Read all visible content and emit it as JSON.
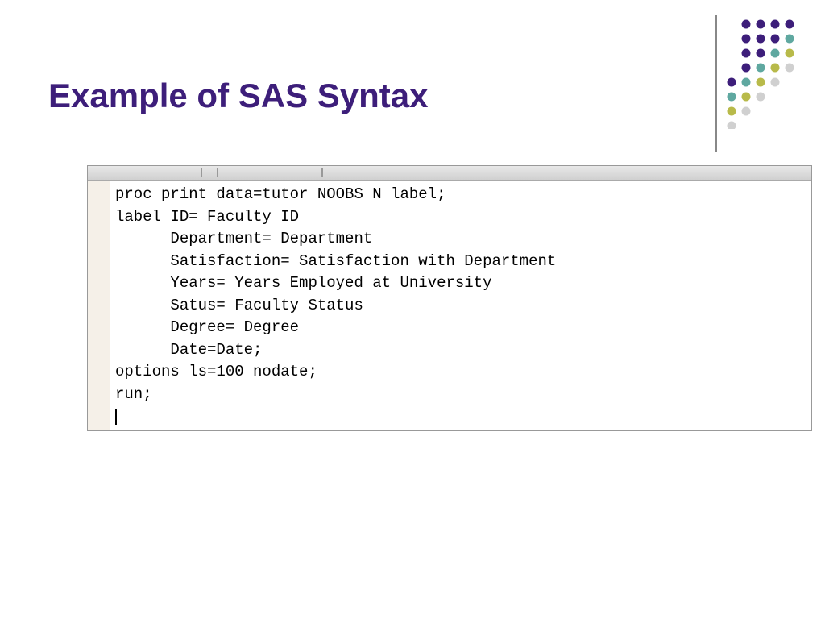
{
  "title": "Example of SAS Syntax",
  "code": {
    "line1": "proc print data=tutor NOOBS N label;",
    "line2": "label ID= Faculty ID",
    "line3": "      Department= Department",
    "line4": "      Satisfaction= Satisfaction with Department",
    "line5": "      Years= Years Employed at University",
    "line6": "      Satus= Faculty Status",
    "line7": "      Degree= Degree",
    "line8": "      Date=Date;",
    "line9": "options ls=100 nodate;",
    "line10": "run;"
  },
  "decoration": {
    "colors": {
      "purple": "#3d1e7a",
      "teal": "#5fa8a0",
      "olive": "#b8ba4a",
      "light": "#d0d0d0"
    }
  }
}
